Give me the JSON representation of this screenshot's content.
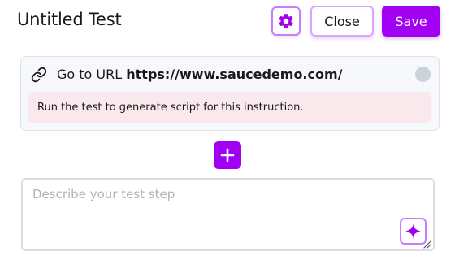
{
  "header": {
    "title": "Untitled Test",
    "close_label": "Close",
    "save_label": "Save"
  },
  "step": {
    "action": "Go to URL",
    "url": "https://www.saucedemo.com/",
    "notice": "Run the test to generate script for this instruction."
  },
  "composer": {
    "placeholder": "Describe your test step",
    "value": ""
  },
  "icons": {
    "settings": "gear-icon",
    "step_type": "link-icon",
    "status": "status-dot",
    "add": "plus-icon",
    "ai": "sparkle-icon"
  },
  "colors": {
    "accent": "#a100f2",
    "accent_border": "#c77dff",
    "card_bg": "#f6f8fb",
    "notice_bg": "#f9e9ec",
    "status_dot": "#cdd3dc"
  }
}
